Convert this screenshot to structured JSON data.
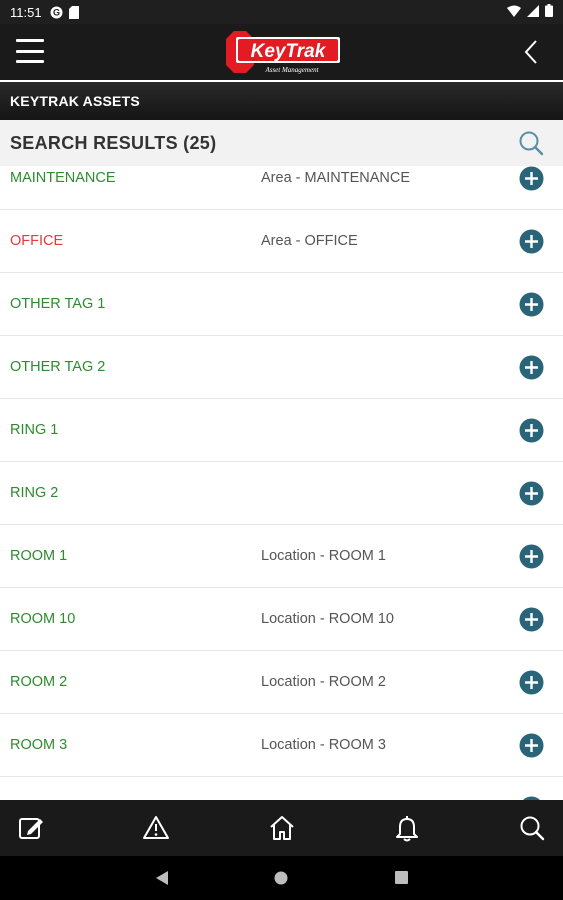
{
  "status_bar": {
    "time": "11:51",
    "icons": [
      "notification-g-icon",
      "sd-card-icon",
      "wifi-icon",
      "cellular-icon",
      "battery-icon"
    ]
  },
  "app_bar": {
    "logo_text": "KeyTrak",
    "logo_tagline": "Asset Management",
    "menu_icon": "hamburger-menu-icon",
    "back_icon": "chevron-left-icon"
  },
  "subtitle": "KEYTRAK ASSETS",
  "search_header": {
    "title": "SEARCH RESULTS (25)",
    "icon": "search-icon"
  },
  "results": [
    {
      "name": "MAINTENANCE",
      "desc": "Area - MAINTENANCE",
      "color": "#2e8b2e"
    },
    {
      "name": "OFFICE",
      "desc": "Area - OFFICE",
      "color": "#e23b3b"
    },
    {
      "name": "OTHER TAG 1",
      "desc": "",
      "color": "#2e8b2e"
    },
    {
      "name": "OTHER TAG 2",
      "desc": "",
      "color": "#2e8b2e"
    },
    {
      "name": "RING 1",
      "desc": "",
      "color": "#2e8b2e"
    },
    {
      "name": "RING 2",
      "desc": "",
      "color": "#2e8b2e"
    },
    {
      "name": "ROOM 1",
      "desc": "Location - ROOM 1",
      "color": "#2e8b2e"
    },
    {
      "name": "ROOM 10",
      "desc": "Location - ROOM 10",
      "color": "#2e8b2e"
    },
    {
      "name": "ROOM 2",
      "desc": "Location - ROOM 2",
      "color": "#2e8b2e"
    },
    {
      "name": "ROOM 3",
      "desc": "Location - ROOM 3",
      "color": "#2e8b2e"
    },
    {
      "name": "",
      "desc": "",
      "color": "#2e8b2e"
    }
  ],
  "bottom_nav": [
    {
      "name": "edit-icon"
    },
    {
      "name": "warning-icon"
    },
    {
      "name": "home-icon"
    },
    {
      "name": "bell-icon"
    },
    {
      "name": "search-icon"
    }
  ],
  "colors": {
    "green": "#2e8b2e",
    "red": "#e23b3b",
    "add_button": "#2a6478",
    "bar": "#1a1a1a"
  },
  "system_nav": [
    "back-triangle-icon",
    "home-circle-icon",
    "recents-square-icon"
  ]
}
